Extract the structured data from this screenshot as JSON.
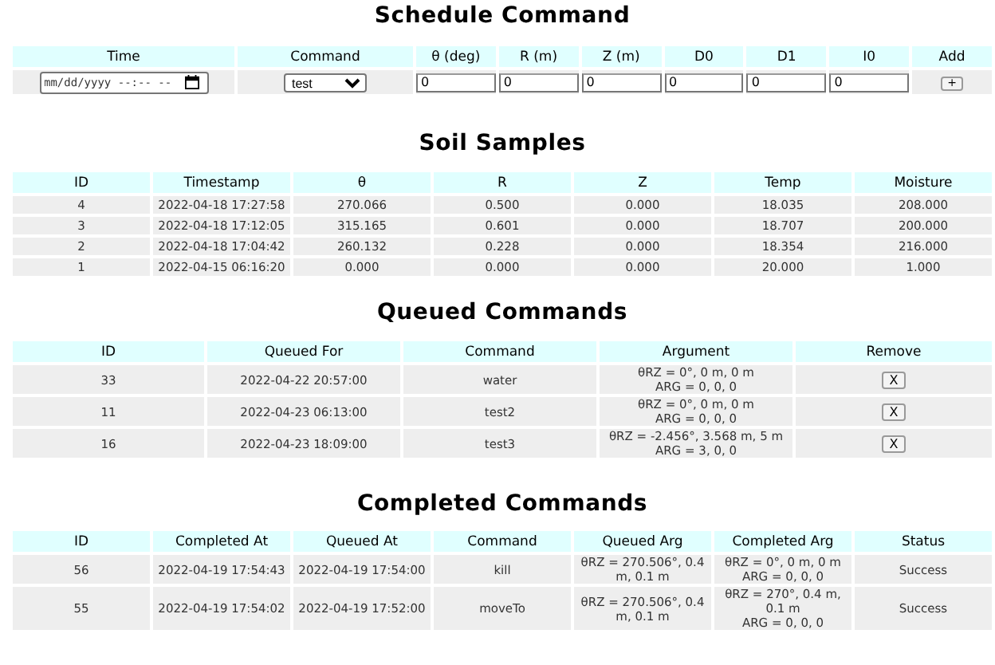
{
  "schedule": {
    "title": "Schedule Command",
    "columns": [
      "Time",
      "Command",
      "θ (deg)",
      "R (m)",
      "Z (m)",
      "D0",
      "D1",
      "I0",
      "Add"
    ],
    "time_field": {
      "placeholder": "mm/dd/yyyy --:-- --"
    },
    "command_select": {
      "value": "test"
    },
    "number_fields": [
      "0",
      "0",
      "0",
      "0",
      "0",
      "0"
    ],
    "add_button": "+"
  },
  "soil_samples": {
    "title": "Soil Samples",
    "columns": [
      "ID",
      "Timestamp",
      "θ",
      "R",
      "Z",
      "Temp",
      "Moisture"
    ],
    "rows": [
      [
        "4",
        "2022-04-18 17:27:58",
        "270.066",
        "0.500",
        "0.000",
        "18.035",
        "208.000"
      ],
      [
        "3",
        "2022-04-18 17:12:05",
        "315.165",
        "0.601",
        "0.000",
        "18.707",
        "200.000"
      ],
      [
        "2",
        "2022-04-18 17:04:42",
        "260.132",
        "0.228",
        "0.000",
        "18.354",
        "216.000"
      ],
      [
        "1",
        "2022-04-15 06:16:20",
        "0.000",
        "0.000",
        "0.000",
        "20.000",
        "1.000"
      ]
    ]
  },
  "queued_commands": {
    "title": "Queued Commands",
    "columns": [
      "ID",
      "Queued For",
      "Command",
      "Argument",
      "Remove"
    ],
    "rows": [
      {
        "id": "33",
        "queued_for": "2022-04-22 20:57:00",
        "command": "water",
        "argument": [
          "θRZ = 0°, 0 m, 0 m",
          "ARG = 0, 0, 0"
        ],
        "remove": "X"
      },
      {
        "id": "11",
        "queued_for": "2022-04-23 06:13:00",
        "command": "test2",
        "argument": [
          "θRZ = 0°, 0 m, 0 m",
          "ARG = 0, 0, 0"
        ],
        "remove": "X"
      },
      {
        "id": "16",
        "queued_for": "2022-04-23 18:09:00",
        "command": "test3",
        "argument": [
          "θRZ = -2.456°, 3.568 m, 5 m",
          "ARG = 3, 0, 0"
        ],
        "remove": "X"
      }
    ]
  },
  "completed_commands": {
    "title": "Completed Commands",
    "columns": [
      "ID",
      "Completed At",
      "Queued At",
      "Command",
      "Queued Arg",
      "Completed Arg",
      "Status"
    ],
    "rows": [
      {
        "id": "56",
        "completed_at": "2022-04-19 17:54:43",
        "queued_at": "2022-04-19 17:54:00",
        "command": "kill",
        "queued_arg": [
          "θRZ = 270.506°, 0.4 m, 0.1 m"
        ],
        "completed_arg": [
          "θRZ = 0°, 0 m, 0 m",
          "ARG = 0, 0, 0"
        ],
        "status": "Success"
      },
      {
        "id": "55",
        "completed_at": "2022-04-19 17:54:02",
        "queued_at": "2022-04-19 17:52:00",
        "command": "moveTo",
        "queued_arg": [
          "θRZ = 270.506°, 0.4 m, 0.1 m"
        ],
        "completed_arg": [
          "θRZ = 270°, 0.4 m, 0.1 m",
          "ARG = 0, 0, 0"
        ],
        "status": "Success"
      }
    ]
  }
}
